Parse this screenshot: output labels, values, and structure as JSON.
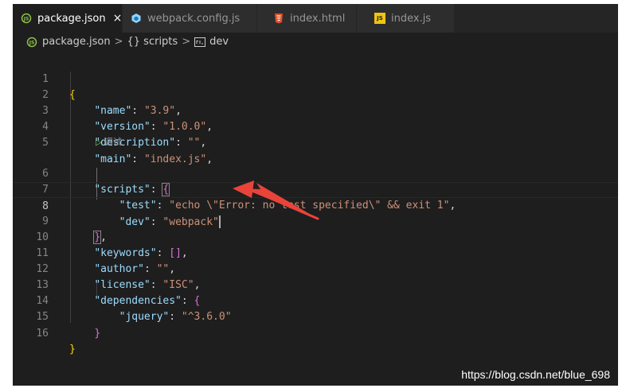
{
  "tabs": [
    {
      "label": "package.json",
      "active": true,
      "icon": "json-icon",
      "close": "×"
    },
    {
      "label": "webpack.config.js",
      "active": false,
      "icon": "webpack-icon"
    },
    {
      "label": "index.html",
      "active": false,
      "icon": "html5-icon"
    },
    {
      "label": "index.js",
      "active": false,
      "icon": "javascript-icon",
      "icon_text": "JS"
    }
  ],
  "breadcrumb": {
    "file": "package.json",
    "object": "{} scripts",
    "key": "dev",
    "separator": ">"
  },
  "codelens": "调试",
  "line_numbers": [
    "1",
    "2",
    "3",
    "4",
    "5",
    "6",
    "7",
    "8",
    "9",
    "10",
    "11",
    "12",
    "13",
    "14",
    "15",
    "16"
  ],
  "code": {
    "l1": "{",
    "l2_key": "\"name\"",
    "l2_val": "\"3.9\"",
    "l3_key": "\"version\"",
    "l3_val": "\"1.0.0\"",
    "l4_key": "\"description\"",
    "l4_val": "\"\"",
    "l5_key": "\"main\"",
    "l5_val": "\"index.js\"",
    "l6_key": "\"scripts\"",
    "l6_brace": "{",
    "l7_key": "\"test\"",
    "l7_val": "\"echo \\\"Error: no test specified\\\" && exit 1\"",
    "l8_key": "\"dev\"",
    "l8_val": "\"webpack\"",
    "l9_brace": "}",
    "l10_key": "\"keywords\"",
    "l10_val": "[]",
    "l11_key": "\"author\"",
    "l11_val": "\"\"",
    "l12_key": "\"license\"",
    "l12_val": "\"ISC\"",
    "l13_key": "\"dependencies\"",
    "l13_brace": "{",
    "l14_key": "\"jquery\"",
    "l14_val": "\"^3.6.0\"",
    "l15_brace": "}",
    "l16": "}"
  },
  "watermark": "https://blog.csdn.net/blue_698",
  "colors": {
    "editor_bg": "#1e1e1e",
    "tab_bar_bg": "#252526",
    "key": "#9cdcfe",
    "string": "#ce9178",
    "bracket_gold": "#ffd700",
    "bracket_purple": "#da70d6",
    "bracket_blue": "#179fff",
    "arrow": "#e8443a"
  }
}
